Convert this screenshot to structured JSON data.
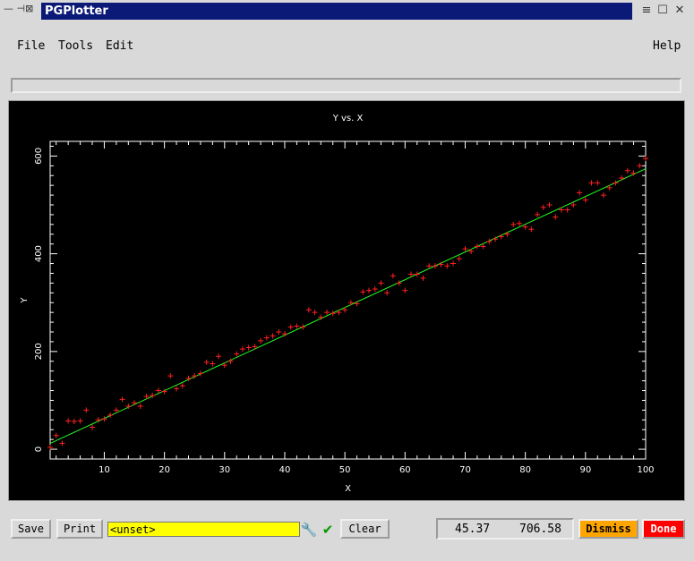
{
  "window": {
    "title": "PGPlotter",
    "left_controls": "— ⊣⊠",
    "controls": [
      "≡",
      "☐",
      "✕"
    ]
  },
  "menu": {
    "file": "File",
    "tools": "Tools",
    "edit": "Edit",
    "help": "Help"
  },
  "status_text": "",
  "plot": {
    "background": "#000000",
    "axis_color": "#ffffff",
    "point_color": "#ff2020",
    "fit_color": "#20ff20"
  },
  "chart_data": {
    "type": "scatter",
    "title": "Y vs. X",
    "xlabel": "X",
    "ylabel": "Y",
    "xlim": [
      1,
      100
    ],
    "ylim": [
      -20,
      630
    ],
    "xticks": [
      10,
      20,
      30,
      40,
      50,
      60,
      70,
      80,
      90,
      100
    ],
    "yticks": [
      0,
      200,
      400,
      600
    ],
    "series": [
      {
        "marker": "+",
        "x": [
          1,
          2,
          3,
          4,
          5,
          6,
          7,
          8,
          9,
          10,
          11,
          12,
          13,
          14,
          15,
          16,
          17,
          18,
          19,
          20,
          21,
          22,
          23,
          24,
          25,
          26,
          27,
          28,
          29,
          30,
          31,
          32,
          33,
          34,
          35,
          36,
          37,
          38,
          39,
          40,
          41,
          42,
          43,
          44,
          45,
          46,
          47,
          48,
          49,
          50,
          51,
          52,
          53,
          54,
          55,
          56,
          57,
          58,
          59,
          60,
          61,
          62,
          63,
          64,
          65,
          66,
          67,
          68,
          69,
          70,
          71,
          72,
          73,
          74,
          75,
          76,
          77,
          78,
          79,
          80,
          81,
          82,
          83,
          84,
          85,
          86,
          87,
          88,
          89,
          90,
          91,
          92,
          93,
          94,
          95,
          96,
          97,
          98,
          99,
          100
        ],
        "y": [
          4,
          28,
          12,
          58,
          57,
          58,
          80,
          45,
          60,
          62,
          70,
          80,
          102,
          88,
          95,
          88,
          108,
          110,
          120,
          118,
          150,
          124,
          130,
          145,
          150,
          155,
          178,
          175,
          190,
          172,
          180,
          195,
          205,
          208,
          210,
          222,
          228,
          232,
          240,
          236,
          250,
          252,
          250,
          285,
          280,
          270,
          280,
          278,
          280,
          285,
          300,
          298,
          322,
          325,
          328,
          340,
          320,
          355,
          340,
          325,
          358,
          358,
          350,
          375,
          375,
          378,
          375,
          380,
          390,
          410,
          405,
          415,
          415,
          425,
          430,
          435,
          440,
          460,
          462,
          455,
          450,
          480,
          495,
          500,
          475,
          490,
          490,
          500,
          525,
          510,
          545,
          545,
          520,
          535,
          545,
          555,
          570,
          565,
          580,
          595
        ]
      },
      {
        "marker": "line",
        "x": [
          1,
          100
        ],
        "y": [
          12,
          574
        ]
      }
    ]
  },
  "buttons": {
    "save": "Save",
    "print": "Print",
    "clear": "Clear",
    "dismiss": "Dismiss",
    "done": "Done"
  },
  "entry_value": "<unset>",
  "icons": {
    "wrench": "🔧",
    "check": "✔"
  },
  "cursor": {
    "x": "45.37",
    "y": "706.58"
  },
  "colors": {
    "entry_bg": "#ffff00",
    "dismiss_bg": "#ffa500",
    "done_bg": "#ff0000",
    "check_color": "#009900"
  }
}
